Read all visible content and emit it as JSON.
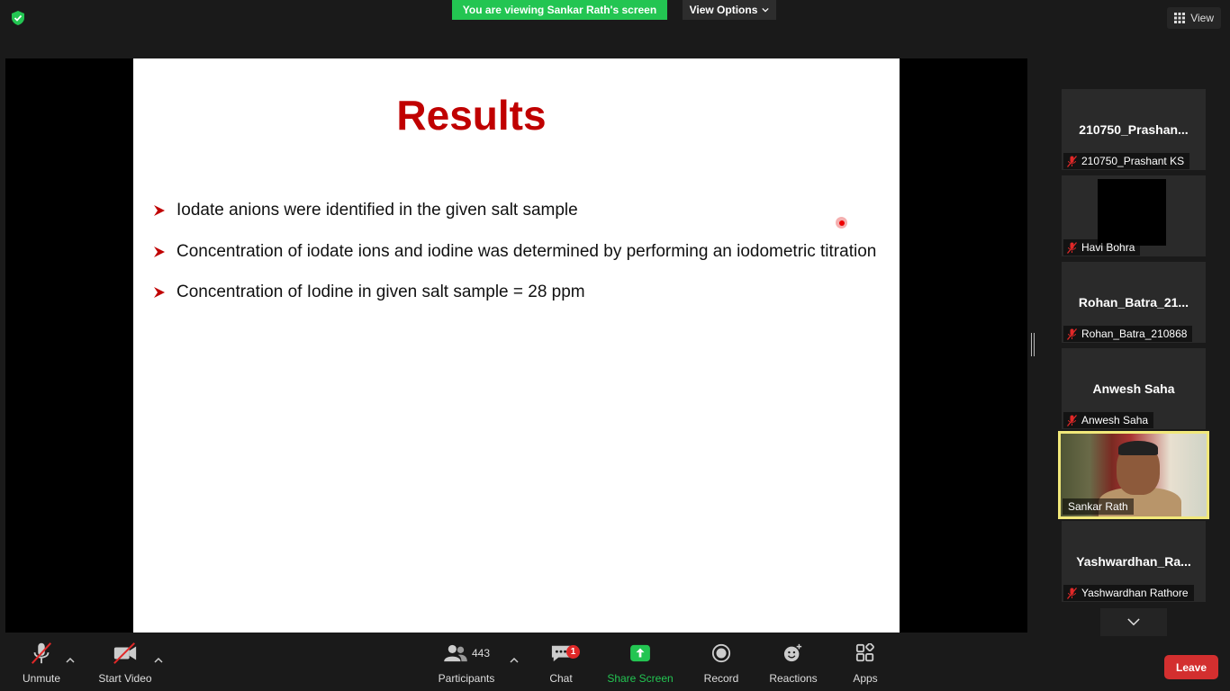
{
  "topbar": {
    "viewing_banner": "You are viewing Sankar Rath's screen",
    "view_options": "View Options",
    "view_label": "View"
  },
  "slide": {
    "title": "Results",
    "bullets": [
      "Iodate anions were identified in the given salt sample",
      "Concentration of iodate ions and iodine was determined by performing an iodometric titration",
      "Concentration of Iodine in given salt sample = 28 ppm"
    ],
    "title_color": "#c00000",
    "bullet_marker_color": "#c00000"
  },
  "participants": [
    {
      "big_name": "210750_Prashan...",
      "tag": "210750_Prashant KS",
      "muted": true
    },
    {
      "big_name": "",
      "tag": "Havi Bohra",
      "muted": true,
      "video_off_black": true
    },
    {
      "big_name": "Rohan_Batra_21...",
      "tag": "Rohan_Batra_210868",
      "muted": true
    },
    {
      "big_name": "Anwesh Saha",
      "tag": "Anwesh Saha",
      "muted": true
    },
    {
      "big_name": "",
      "tag": "Sankar Rath",
      "muted": false,
      "active_speaker": true
    },
    {
      "big_name": "Yashwardhan_Ra...",
      "tag": "Yashwardhan Rathore",
      "muted": true
    }
  ],
  "toolbar": {
    "unmute": "Unmute",
    "start_video": "Start Video",
    "participants": "Participants",
    "participants_count": "443",
    "chat": "Chat",
    "chat_badge": "1",
    "share_screen": "Share Screen",
    "record": "Record",
    "reactions": "Reactions",
    "apps": "Apps",
    "leave": "Leave"
  },
  "colors": {
    "share_green": "#23c552",
    "leave_red": "#d32f2f",
    "active_speaker_border": "#f1e87a",
    "mute_red": "#e02828"
  }
}
